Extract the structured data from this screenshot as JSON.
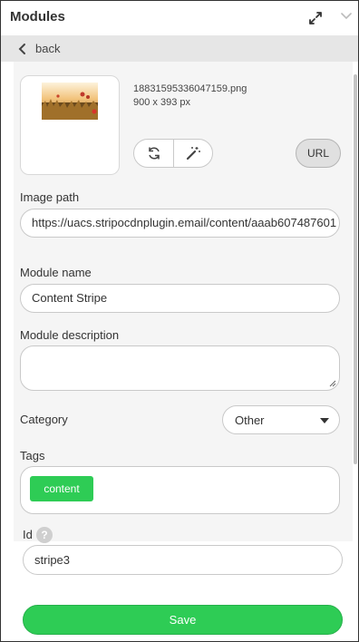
{
  "header": {
    "title": "Modules"
  },
  "back": {
    "label": "back"
  },
  "image": {
    "file_name": "18831595336047159.png",
    "dimensions": "900 x 393 px"
  },
  "buttons": {
    "url_label": "URL",
    "save_label": "Save"
  },
  "image_path": {
    "label": "Image path",
    "value": "https://uacs.stripocdnplugin.email/content/aaab607487601"
  },
  "module_name": {
    "label": "Module name",
    "value": "Content Stripe"
  },
  "module_description": {
    "label": "Module description",
    "value": ""
  },
  "category": {
    "label": "Category",
    "selected": "Other"
  },
  "tags": {
    "label": "Tags",
    "items": [
      "content"
    ]
  },
  "id_field": {
    "label": "Id",
    "help": "?",
    "value": "stripe3"
  },
  "colors": {
    "accent": "#2ecc55",
    "panel": "#f5f5f5",
    "back_bar": "#e6e6e6"
  },
  "icons": {
    "expand": "expand-icon",
    "collapse": "chevron-down-icon",
    "back": "chevron-left-icon",
    "replace": "refresh-icon",
    "edit": "magic-wand-icon"
  }
}
